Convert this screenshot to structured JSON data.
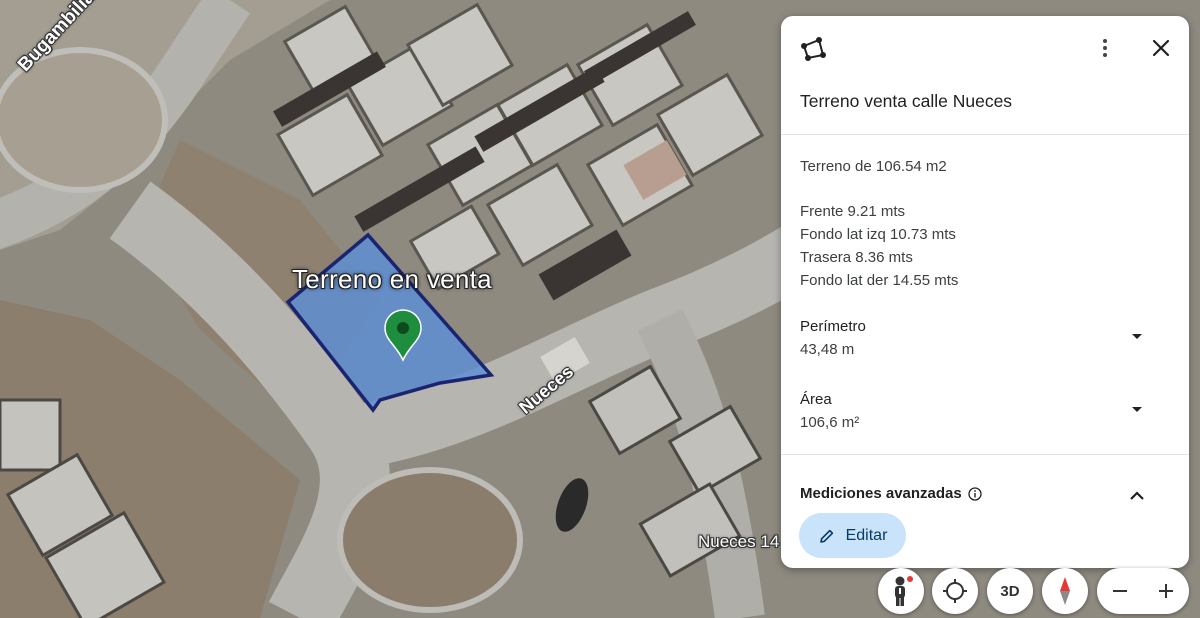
{
  "map": {
    "street_labels": [
      "Bugambilias",
      "Nueces",
      "Nueces 14"
    ],
    "parcel_label": "Terreno en venta",
    "parcel_fill": "#5b8fd6",
    "parcel_outline": "#1a2470",
    "pin_color": "#1e8e3e"
  },
  "panel": {
    "header_icon": "polygon-icon",
    "title": "Terreno venta calle Nueces",
    "description": [
      "Terreno de 106.54 m2",
      "",
      "Frente 9.21 mts",
      "Fondo lat izq 10.73 mts",
      "Trasera 8.36 mts",
      "Fondo lat der 14.55 mts"
    ],
    "perimeter": {
      "label": "Perímetro",
      "value": "43,48 m"
    },
    "area": {
      "label": "Área",
      "value": "106,6 m²"
    },
    "advanced": {
      "label": "Mediciones avanzadas"
    },
    "edit_button": "Editar"
  },
  "controls": {
    "three_d_label": "3D"
  }
}
